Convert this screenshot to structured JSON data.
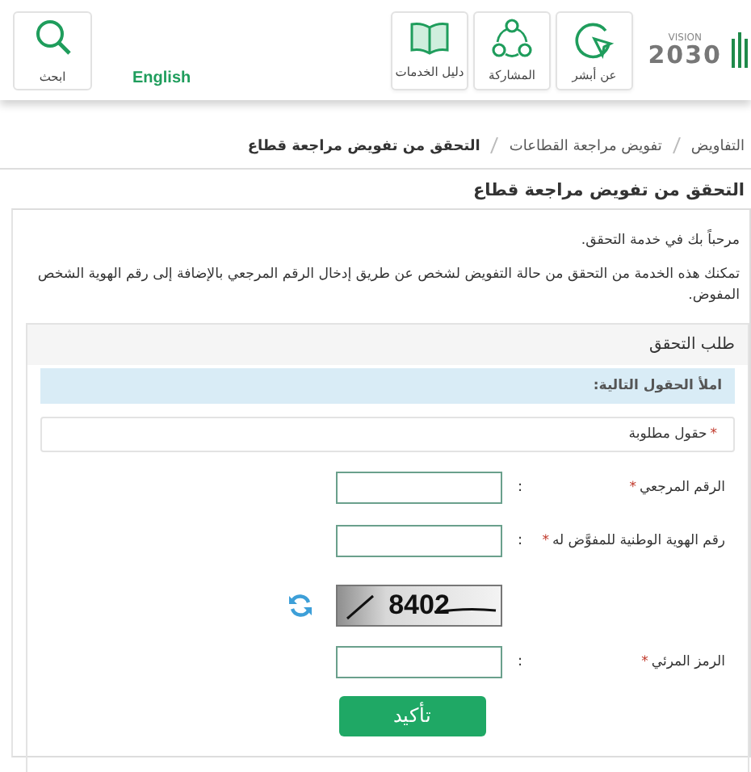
{
  "header": {
    "logo": {
      "vision": "VISION",
      "year": "2030"
    },
    "nav": [
      {
        "label": "عن أبشر",
        "kind": "about"
      },
      {
        "label": "المشاركة",
        "kind": "participation"
      },
      {
        "label": "دليل الخدمات",
        "kind": "guide"
      }
    ],
    "language": "English",
    "search": "ابحث"
  },
  "breadcrumb": [
    {
      "label": "التفاويض",
      "current": false
    },
    {
      "label": "تفويض مراجعة القطاعات",
      "current": false
    },
    {
      "label": "التحقق من تفويض مراجعة قطاع",
      "current": true
    }
  ],
  "page_title": "التحقق من تفويض مراجعة قطاع",
  "welcome": "مرحباً بك في خدمة التحقق.",
  "description": "تمكنك هذه الخدمة من التحقق من حالة التفويض لشخص عن طريق إدخال الرقم المرجعي بالإضافة إلى رقم الهوية الشخص المفوض.",
  "form": {
    "title": "طلب التحقق",
    "info": "املأ الحقول التالية:",
    "required_mark": "*",
    "required_note": "حقول مطلوبة",
    "fields": [
      {
        "kind": "input",
        "label": "الرقم المرجعي",
        "mark": "*",
        "colon": ":"
      },
      {
        "kind": "input",
        "label": "رقم الهوية الوطنية للمفوَّض له",
        "mark": "*",
        "colon": ":"
      },
      {
        "kind": "captcha",
        "code": "8402"
      },
      {
        "kind": "input",
        "label": "الرمز المرئي",
        "mark": "*",
        "colon": ":"
      }
    ],
    "submit": "تأكيد"
  }
}
